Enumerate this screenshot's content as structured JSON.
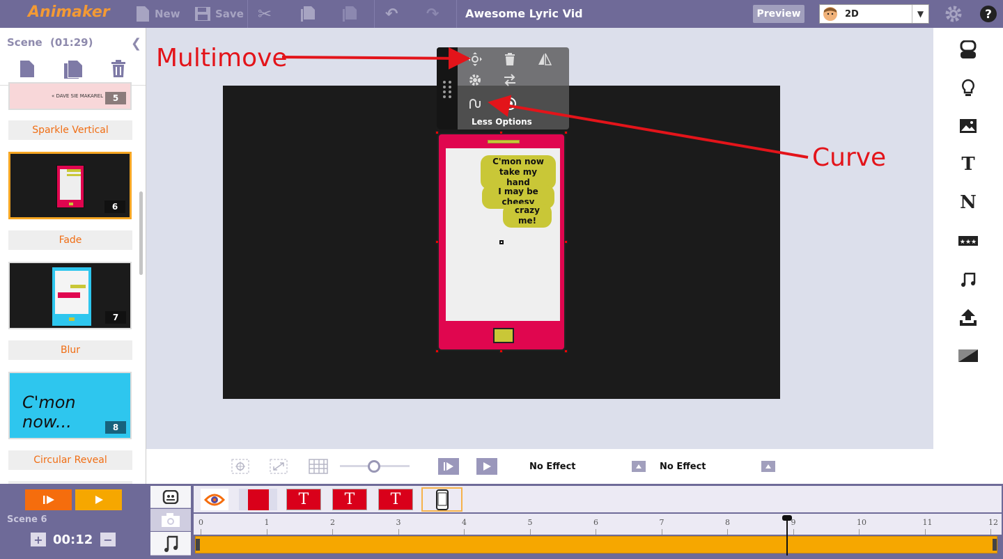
{
  "topbar": {
    "logo": "Animaker",
    "new_label": "New",
    "save_label": "Save",
    "doc_title": "Awesome Lyric Vid",
    "preview_label": "Preview",
    "mode": "2D"
  },
  "scene_panel": {
    "header": "Scene",
    "duration": "(01:29)",
    "scenes": [
      {
        "number": "5",
        "thumb_text": "« DAVE SIE MAKAREL"
      },
      {
        "number": "6",
        "thumb_text": ""
      },
      {
        "number": "7",
        "thumb_text": ""
      },
      {
        "number": "8",
        "thumb_text": "C'mon now..."
      }
    ],
    "transitions": [
      "Sparkle Vertical",
      "Fade",
      "Blur",
      "Circular Reveal"
    ]
  },
  "toolbox": {
    "less_options": "Less Options"
  },
  "phone": {
    "bubbles": [
      "C'mon now take my hand",
      "I may be cheesy",
      "crazy me!"
    ]
  },
  "annotations": {
    "multimove": "Multimove",
    "curve": "Curve"
  },
  "controls": {
    "effect_in": "No Effect",
    "effect_out": "No Effect"
  },
  "timeline": {
    "scene_label": "Scene  6",
    "time": "00:12",
    "ticks": [
      "0",
      "1",
      "2",
      "3",
      "4",
      "5",
      "6",
      "7",
      "8",
      "9",
      "10",
      "11",
      "12"
    ],
    "object_text_glyph": "T"
  },
  "colors": {
    "topbar": "#6f6a98",
    "accent_orange": "#f39a35",
    "timeline_bar": "#f6a700",
    "phone_body": "#e0064f",
    "bubble": "#c9c737",
    "annotation_red": "#e3141a"
  }
}
